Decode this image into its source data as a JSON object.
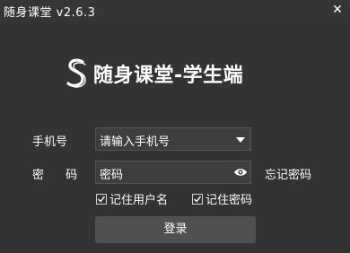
{
  "window": {
    "title": "随身课堂 v2.6.3",
    "close_label": "✕"
  },
  "brand": {
    "title": "随身课堂-学生端"
  },
  "form": {
    "phone_label": "手机号",
    "phone_value": "请输入手机号",
    "password_label": "密 码",
    "password_value": "密码",
    "forgot_label": "忘记密码",
    "remember_user_label": "记住用户名",
    "remember_user_checked": true,
    "remember_password_label": "记住密码",
    "remember_password_checked": true,
    "login_label": "登录"
  },
  "icons": {
    "logo": "brand-s-logo-icon",
    "dropdown": "chevron-down-icon",
    "eye": "eye-icon",
    "check": "checkmark-icon",
    "close": "close-icon"
  },
  "colors": {
    "background": "#333333",
    "input_background": "#3e3e3e",
    "button_background": "#505050",
    "text": "#ffffff"
  }
}
